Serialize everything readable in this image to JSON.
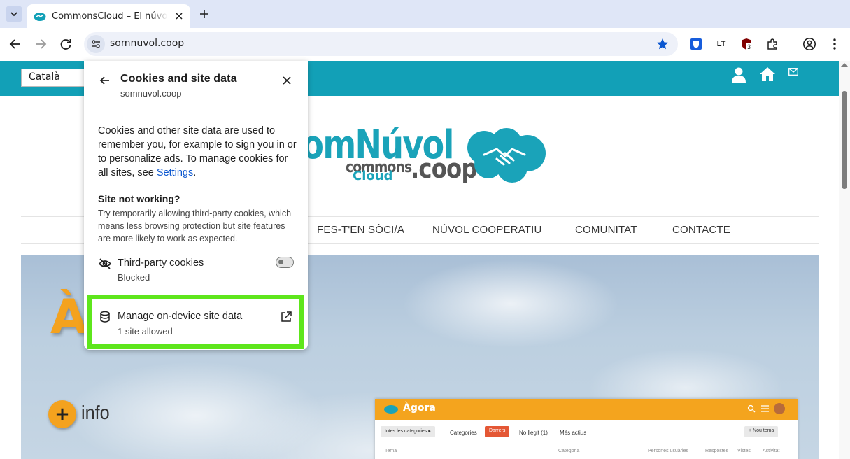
{
  "browser": {
    "tab": {
      "title": "CommonsCloud – El núvol cooperatiu"
    },
    "url": "somnuvol.coop",
    "extensions": {
      "badge_count": "3",
      "lt_label": "LT"
    }
  },
  "site": {
    "language": "Català",
    "logo": {
      "title": "SomNúvol",
      "commons": "commons",
      "cloud": "Cloud",
      "coop": ".coop"
    },
    "menu": [
      "FES-T'EN SÒCI/A",
      "NÚVOL COOPERATIU",
      "COMUNITAT",
      "CONTACTE"
    ],
    "hero": {
      "big_text": "Àg",
      "info_plus": "+",
      "info_label": "info",
      "agora": {
        "title": "Àgora",
        "categories_dropdown": "totes les categories",
        "tabs": [
          "Categories",
          "Darrers",
          "No llegit (1)",
          "Més actius"
        ],
        "new_topic": "Nou tema",
        "columns": [
          "Tema",
          "Categoria",
          "Persones usuàries",
          "Respostes",
          "Vistes",
          "Activitat"
        ]
      }
    }
  },
  "popup": {
    "title": "Cookies and site data",
    "subtitle": "somnuvol.coop",
    "description": "Cookies and other site data are used to remember you, for example to sign you in or to personalize ads. To manage cookies for all sites, see ",
    "settings_link": "Settings",
    "description_end": ".",
    "site_not_working": {
      "heading": "Site not working?",
      "text": "Try temporarily allowing third-party cookies, which means less browsing protection but site features are more likely to work as expected."
    },
    "third_party": {
      "label": "Third-party cookies",
      "status": "Blocked",
      "enabled": false
    },
    "on_device": {
      "label": "Manage on-device site data",
      "status": "1 site allowed"
    }
  },
  "colors": {
    "accent": "#12a0b7",
    "orange": "#f4a21e",
    "highlight": "#5ee61c",
    "link": "#0b57d0"
  }
}
